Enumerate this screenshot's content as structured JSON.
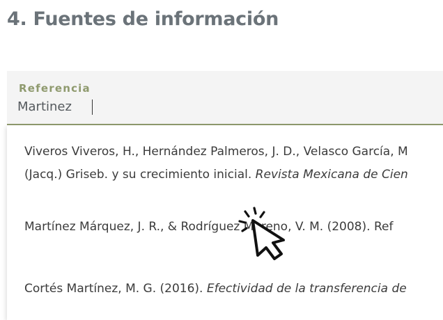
{
  "section_title": "4. Fuentes de información",
  "reference_field": {
    "label": "Referencia",
    "value": "Martinez"
  },
  "suggestions": [
    {
      "line1": "Viveros Viveros, H., Hernández Palmeros, J. D., Velasco García, M",
      "line2_plain": "(Jacq.) Griseb. y su crecimiento inicial. ",
      "line2_italic": "Revista Mexicana de Cien"
    },
    {
      "line1": "Martínez Márquez, J. R., & Rodríguez Moreno, V. M. (2008). Ref"
    },
    {
      "line1_plain": "Cortés Martínez, M. G. (2016). ",
      "line1_italic": "Efectividad de la transferencia de"
    }
  ],
  "cursor_icon": "click-pointer-icon"
}
